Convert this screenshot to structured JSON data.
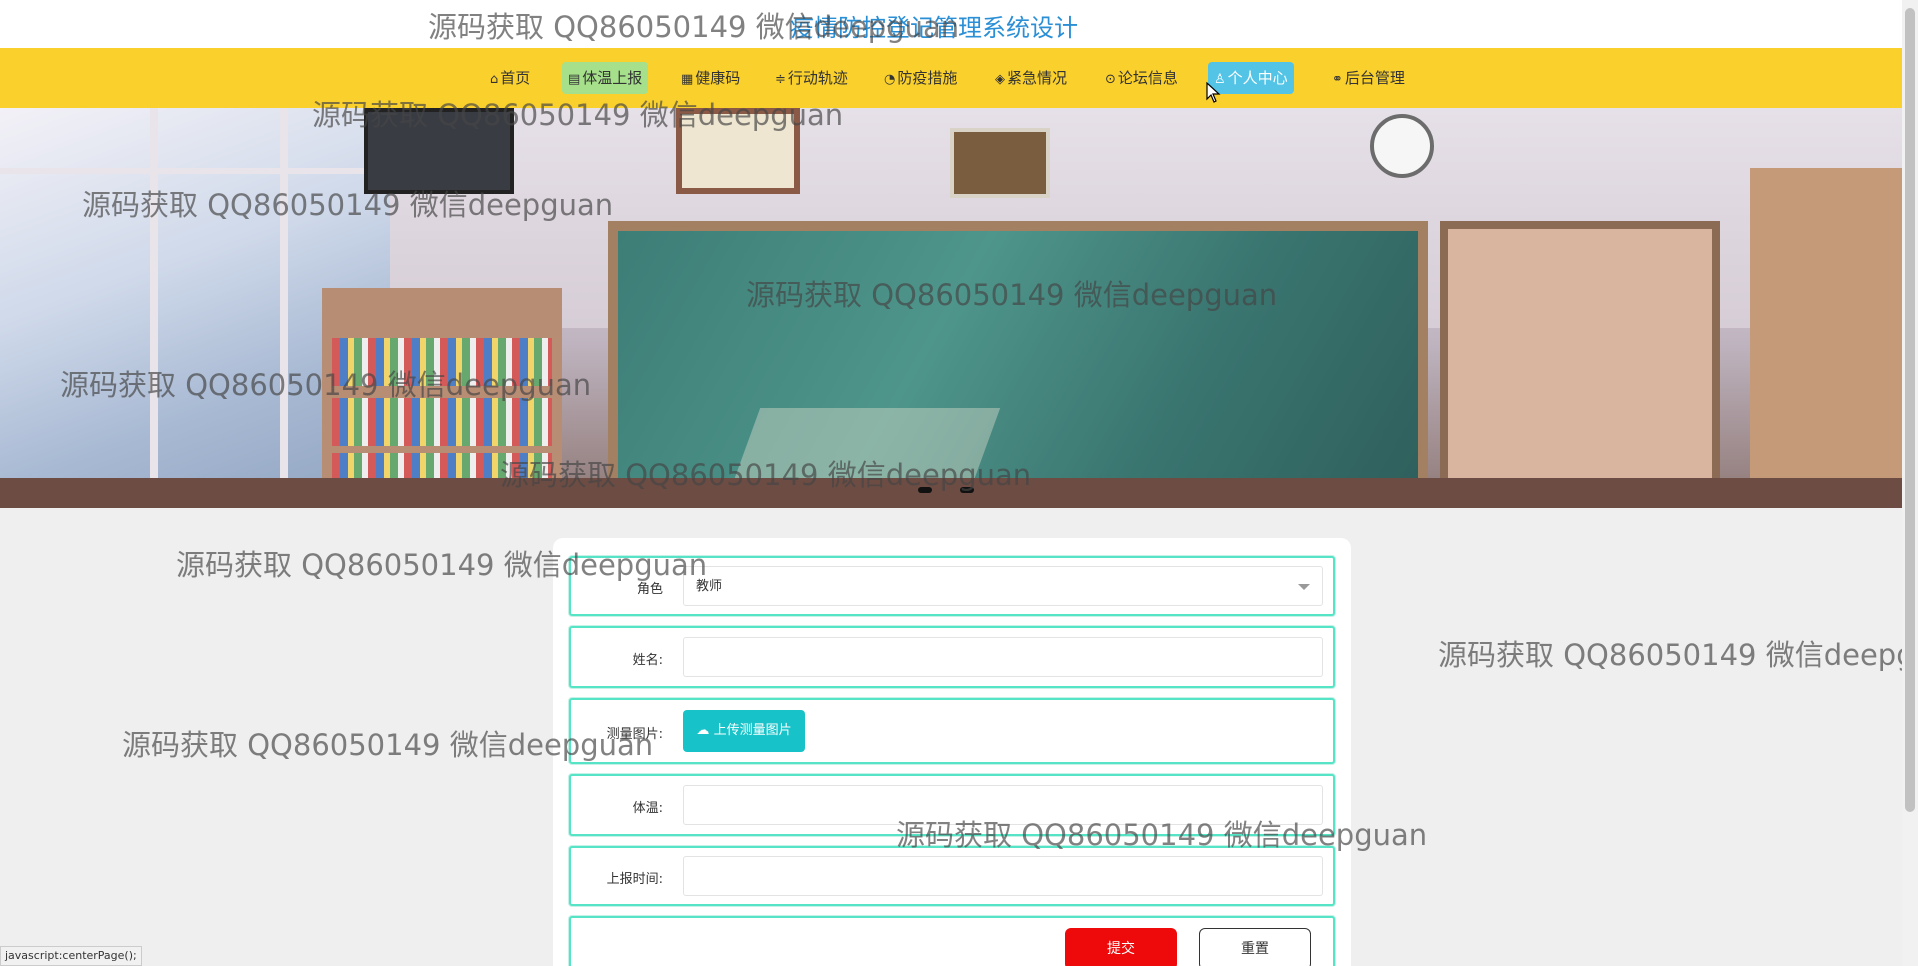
{
  "header": {
    "site_title": "疫情防控登记管理系统设计"
  },
  "nav": {
    "items": [
      {
        "label": "首页",
        "icon": "home-icon"
      },
      {
        "label": "体温上报",
        "icon": "document-icon",
        "active": true
      },
      {
        "label": "健康码",
        "icon": "calendar-icon"
      },
      {
        "label": "行动轨迹",
        "icon": "sliders-icon"
      },
      {
        "label": "防疫措施",
        "icon": "gauge-icon"
      },
      {
        "label": "紧急情况",
        "icon": "layers-icon"
      },
      {
        "label": "论坛信息",
        "icon": "chat-icon"
      },
      {
        "label": "个人中心",
        "icon": "user-icon",
        "hover": true
      },
      {
        "label": "后台管理",
        "icon": "link-icon"
      }
    ]
  },
  "banner": {
    "slide_count": 2
  },
  "form": {
    "role": {
      "label": "角色",
      "value": "教师"
    },
    "name": {
      "label": "姓名:",
      "value": ""
    },
    "photo": {
      "label": "测量图片:",
      "button": "上传测量图片"
    },
    "temperature": {
      "label": "体温:",
      "value": ""
    },
    "report_time": {
      "label": "上报时间:",
      "value": ""
    },
    "submit": "提交",
    "reset": "重置"
  },
  "status_bar": "javascript:centerPage();",
  "watermark": "源码获取 QQ86050149 微信deepguan",
  "colors": {
    "nav_bg": "#fad02c",
    "active_tab": "#a6e08b",
    "hover_tab": "#53c4e6",
    "title": "#2b8fd6",
    "submit": "#ee0a0a",
    "upload": "#17c3c8",
    "field_border": "#56e4c7"
  }
}
